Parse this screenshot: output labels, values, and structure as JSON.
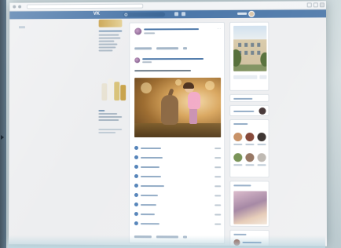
{
  "browser": {
    "address": ""
  },
  "header": {
    "logo": "VK",
    "search_placeholder": "",
    "user_name": ""
  },
  "ads": {
    "title": "",
    "lines": []
  },
  "post": {
    "author": "",
    "date": "",
    "repost_source": "",
    "text": "",
    "poll_options": [
      {
        "label": "",
        "count": ""
      },
      {
        "label": "",
        "count": ""
      },
      {
        "label": "",
        "count": ""
      },
      {
        "label": "",
        "count": ""
      },
      {
        "label": "",
        "count": ""
      },
      {
        "label": "",
        "count": ""
      },
      {
        "label": "",
        "count": ""
      },
      {
        "label": "",
        "count": ""
      },
      {
        "label": "",
        "count": ""
      }
    ],
    "actions": {
      "like": "",
      "comment": ""
    }
  },
  "right": {
    "message_button": "",
    "gifts_label": "",
    "friends_title": "",
    "photos_title": "",
    "contacts_title": ""
  },
  "colors": {
    "vk_blue": "#4a76a8",
    "link": "#2a5885",
    "page_bg": "#edeef0",
    "card_bg": "#ffffff"
  }
}
